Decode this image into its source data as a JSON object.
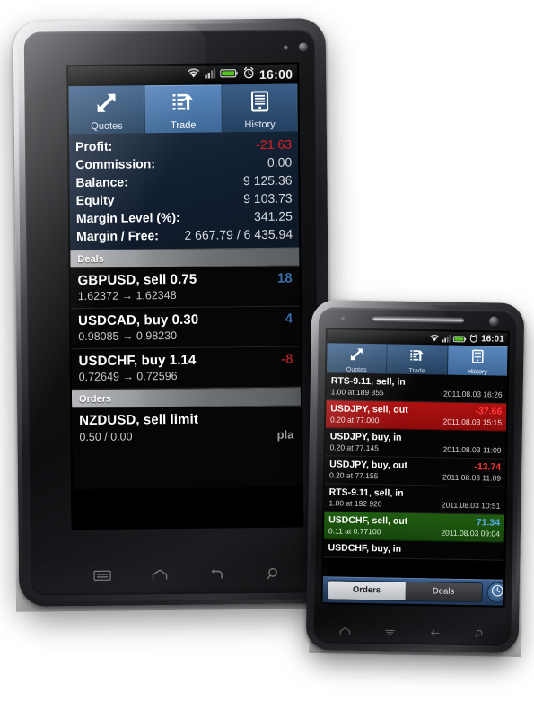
{
  "tablet": {
    "status_bar": {
      "time": "16:00",
      "icons": [
        "wifi-icon",
        "signal-icon",
        "battery-icon",
        "alarm-icon"
      ]
    },
    "tabs": [
      {
        "label": "Quotes",
        "icon": "quotes-arrows-icon",
        "selected": false
      },
      {
        "label": "Trade",
        "icon": "trade-list-arrow-icon",
        "selected": true
      },
      {
        "label": "History",
        "icon": "history-document-icon",
        "selected": false
      }
    ],
    "account": [
      {
        "key": "Profit:",
        "value": "-21.63",
        "negative": true
      },
      {
        "key": "Commission:",
        "value": "0.00",
        "negative": false
      },
      {
        "key": "Balance:",
        "value": "9 125.36",
        "negative": false
      },
      {
        "key": "Equity",
        "value": "9 103.73",
        "negative": false
      },
      {
        "key": "Margin Level (%):",
        "value": "341.25",
        "negative": false
      },
      {
        "key": "Margin / Free:",
        "value": "2 667.79 / 6 435.94",
        "negative": false
      }
    ],
    "deals_header": "Deals",
    "deals": [
      {
        "symbol": "GBPUSD, sell 0.75",
        "prices": "1.62372 → 1.62348",
        "profit": "18",
        "sign": "pos"
      },
      {
        "symbol": "USDCAD, buy 0.30",
        "prices": "0.98085 → 0.98230",
        "profit": "4",
        "sign": "pos"
      },
      {
        "symbol": "USDCHF, buy 1.14",
        "prices": "0.72649 → 0.72596",
        "profit": "-8",
        "sign": "neg"
      }
    ],
    "orders_header": "Orders",
    "orders": [
      {
        "symbol": "NZDUSD, sell limit",
        "prices": "0.50 / 0.00",
        "extra": "pla"
      }
    ],
    "nav_buttons": [
      "menu-icon",
      "home-icon",
      "back-icon",
      "search-icon"
    ]
  },
  "phone": {
    "status_bar": {
      "time": "16:01",
      "icons": [
        "wifi-icon",
        "signal-icon",
        "battery-icon",
        "alarm-icon"
      ]
    },
    "tabs": [
      {
        "label": "Quotes",
        "icon": "quotes-arrows-icon",
        "selected": false
      },
      {
        "label": "Trade",
        "icon": "trade-list-arrow-icon",
        "selected": false
      },
      {
        "label": "History",
        "icon": "history-document-icon",
        "selected": true
      }
    ],
    "history": [
      {
        "symbol": "RTS-9.11, sell, in",
        "detail": "1.00 at 189 355",
        "time": "2011.08.03 16:26",
        "value": "",
        "state": "none"
      },
      {
        "symbol": "USDJPY, sell, out",
        "detail": "0.20 at 77.000",
        "time": "2011.08.03 15:15",
        "value": "-37.66",
        "state": "red"
      },
      {
        "symbol": "USDJPY, buy, in",
        "detail": "0.20 at 77.145",
        "time": "2011.08.03 11:09",
        "value": "",
        "state": "none"
      },
      {
        "symbol": "USDJPY, buy, out",
        "detail": "0.20 at 77.155",
        "time": "2011.08.03 11:09",
        "value": "-13.74",
        "state": "none-neg"
      },
      {
        "symbol": "RTS-9.11, sell, in",
        "detail": "1.00 at 192 920",
        "time": "2011.08.03 10:51",
        "value": "",
        "state": "none"
      },
      {
        "symbol": "USDCHF, sell, out",
        "detail": "0.11 at 0.77100",
        "time": "2011.08.03 09:04",
        "value": "71.34",
        "state": "green"
      },
      {
        "symbol": "USDCHF, buy, in",
        "detail": "",
        "time": "",
        "value": "",
        "state": "none"
      }
    ],
    "segmented": {
      "left": "Orders",
      "right": "Deals",
      "selected": "Orders"
    },
    "clock_button": "clock-icon",
    "nav_buttons": [
      "home-icon",
      "menu-icon",
      "back-icon",
      "search-icon"
    ]
  },
  "colors": {
    "accent_blue": "#3d6796",
    "profit_red": "#e02020",
    "profit_blue": "#3c6ea8",
    "row_red": "#b01010",
    "row_green": "#1f5d10"
  }
}
